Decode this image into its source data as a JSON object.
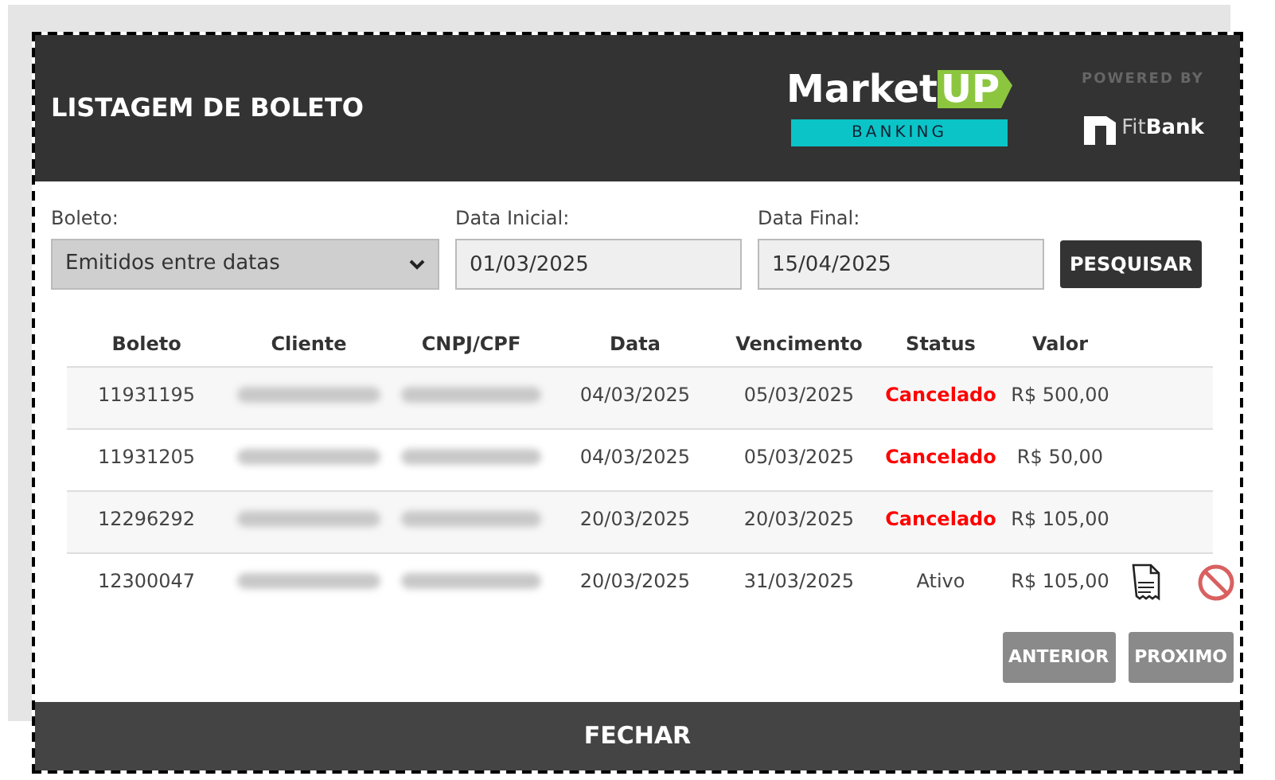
{
  "dialog": {
    "title": "LISTAGEM DE BOLETO"
  },
  "logo": {
    "brand": "Market",
    "brand_highlight": "UP",
    "tagline": "BANKING",
    "powered_by": "POWERED BY",
    "partner_light": "Fit",
    "partner_bold": "Bank"
  },
  "filters": [
    {
      "kind": "select",
      "label": "Boleto:",
      "value": "Emitidos entre datas"
    },
    {
      "kind": "input",
      "label": "Data Inicial:",
      "value": "01/03/2025"
    },
    {
      "kind": "input",
      "label": "Data Final:",
      "value": "15/04/2025"
    }
  ],
  "search_button": "PESQUISAR",
  "table": {
    "columns": [
      "Boleto",
      "Cliente",
      "CNPJ/CPF",
      "Data",
      "Vencimento",
      "Status",
      "Valor"
    ],
    "rows": [
      {
        "boleto": "11931195",
        "data": "04/03/2025",
        "vencimento": "05/03/2025",
        "status": "Cancelado",
        "cancelled": true,
        "valor": "R$ 500,00",
        "actions": false
      },
      {
        "boleto": "11931205",
        "data": "04/03/2025",
        "vencimento": "05/03/2025",
        "status": "Cancelado",
        "cancelled": true,
        "valor": "R$ 50,00",
        "actions": false
      },
      {
        "boleto": "12296292",
        "data": "20/03/2025",
        "vencimento": "20/03/2025",
        "status": "Cancelado",
        "cancelled": true,
        "valor": "R$ 105,00",
        "actions": false
      },
      {
        "boleto": "12300047",
        "data": "20/03/2025",
        "vencimento": "31/03/2025",
        "status": "Ativo",
        "cancelled": false,
        "valor": "R$ 105,00",
        "actions": true
      }
    ]
  },
  "pagination": [
    "ANTERIOR",
    "PROXIMO"
  ],
  "close_button": "FECHAR"
}
